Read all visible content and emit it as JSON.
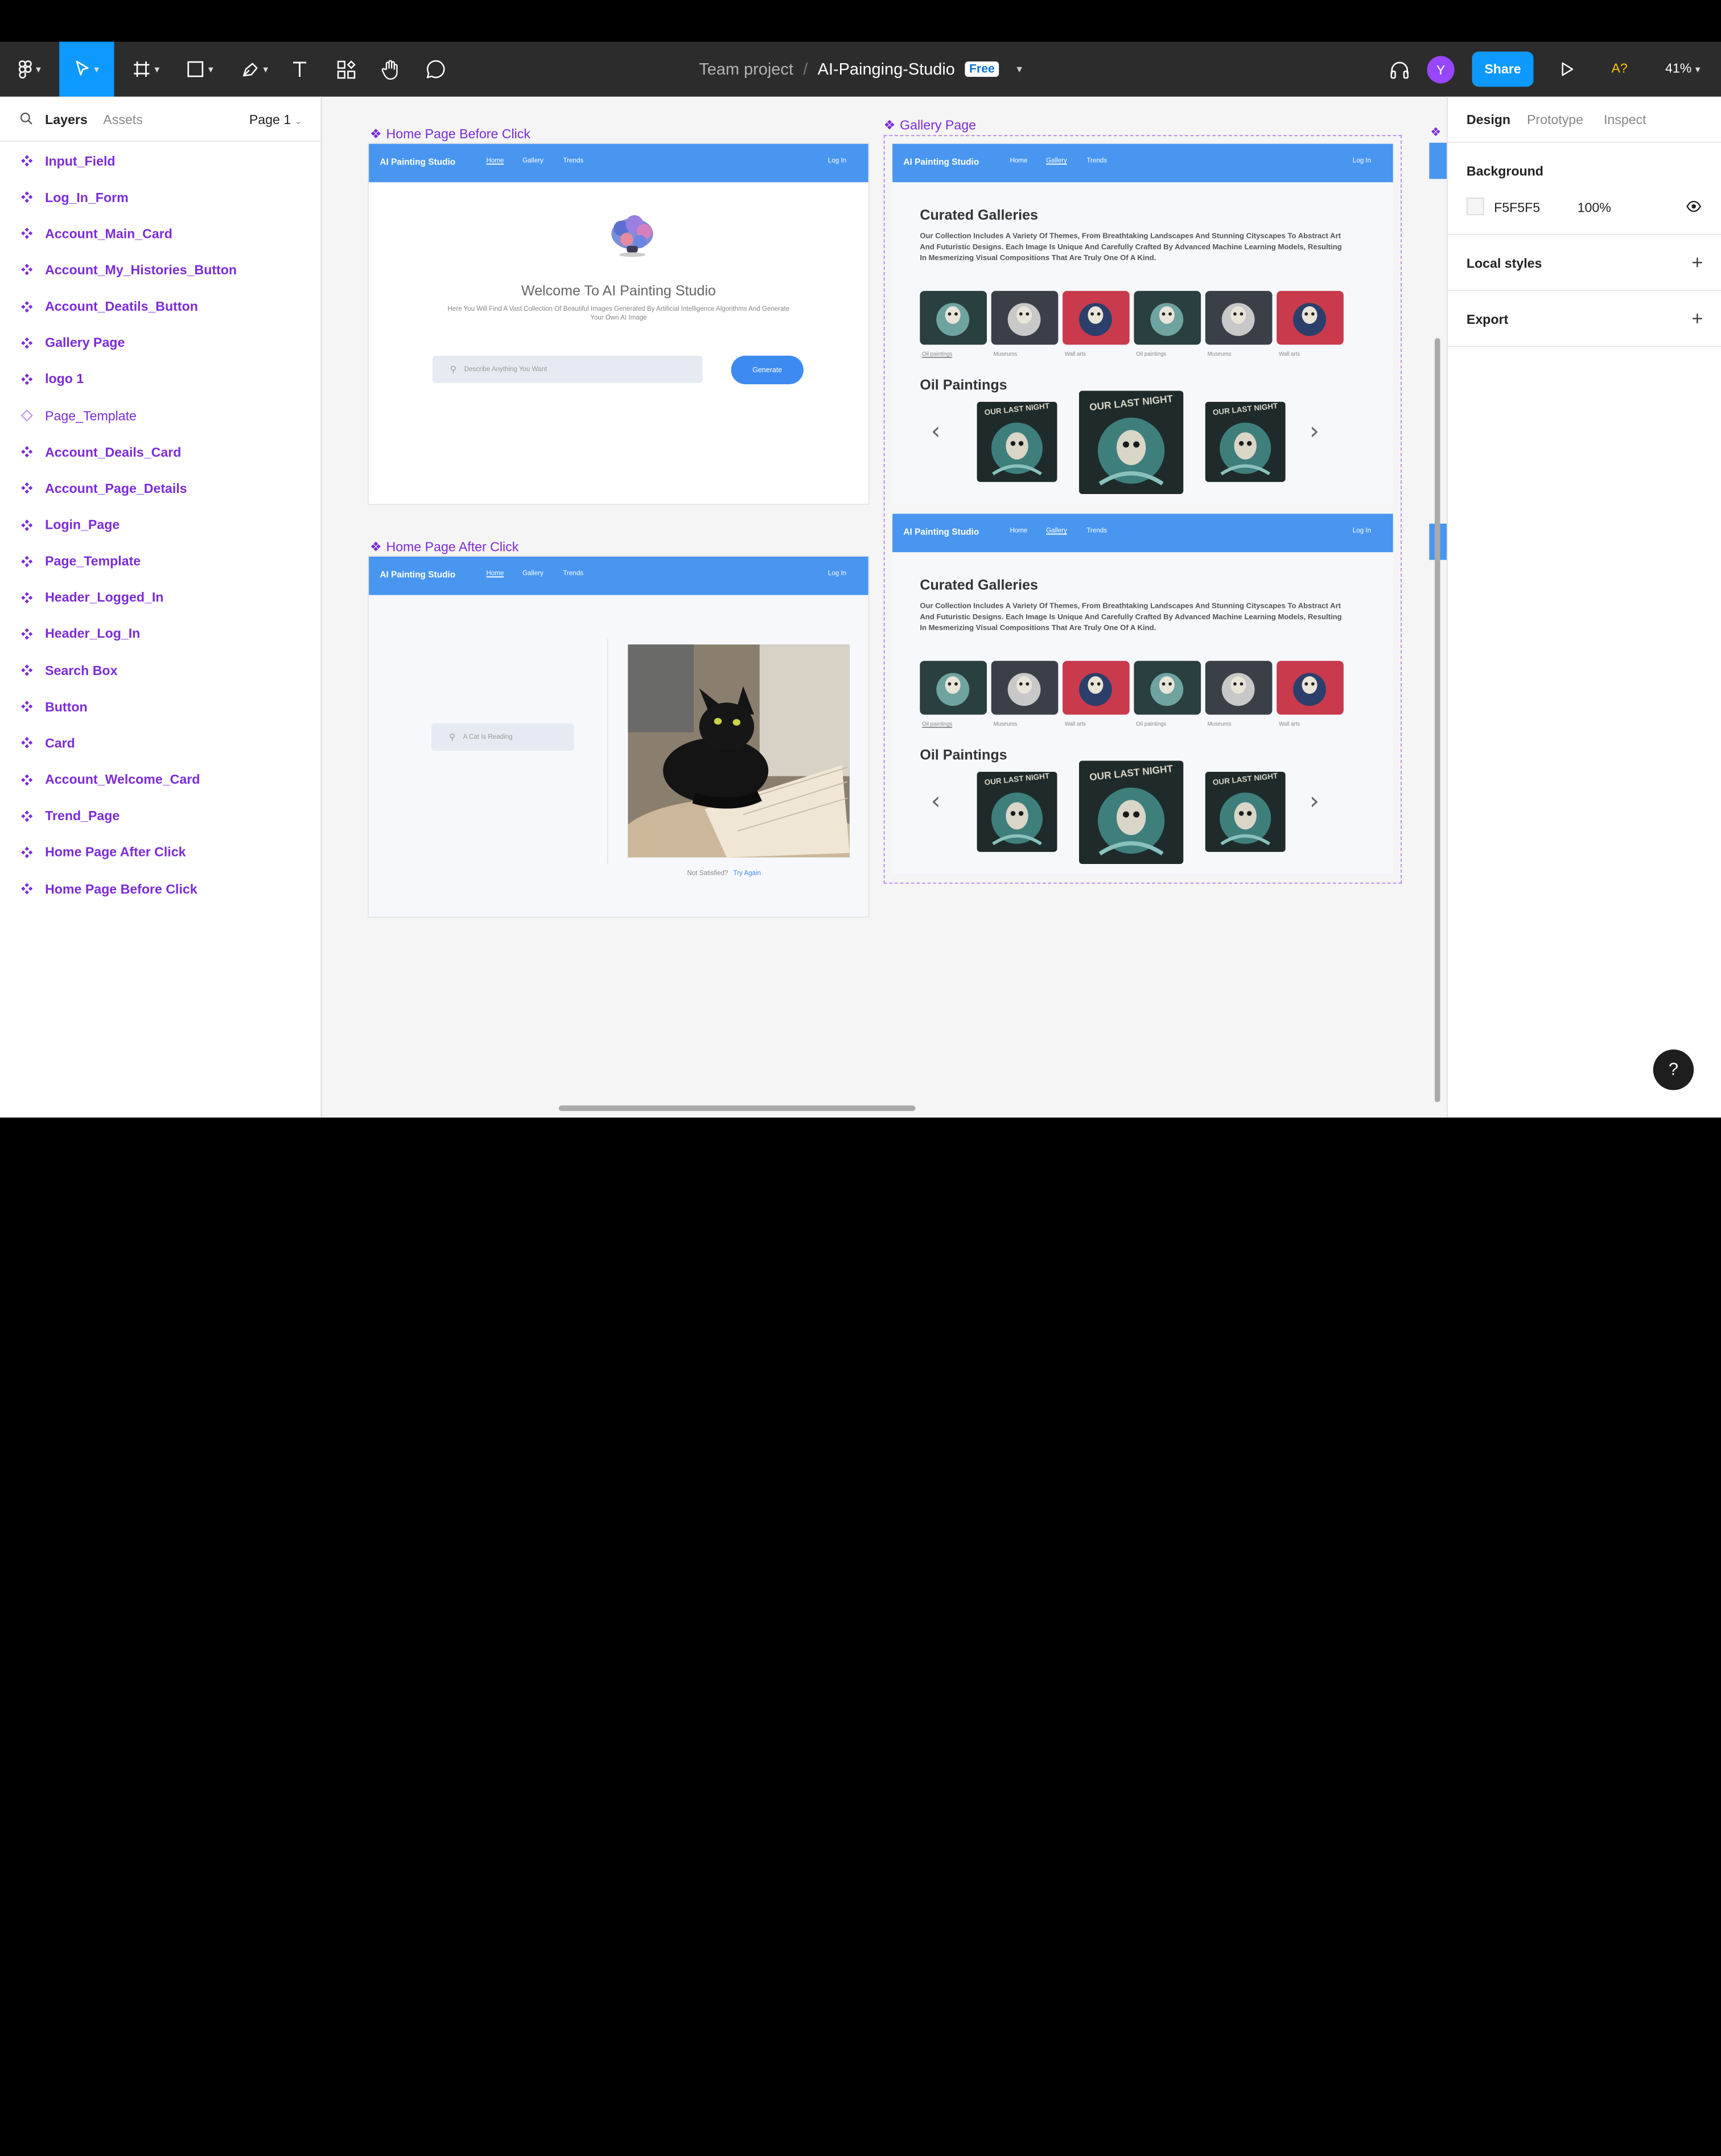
{
  "toolbar": {
    "breadcrumb_team": "Team project",
    "breadcrumb_sep": "/",
    "file_name": "AI-Painging-Studio",
    "plan_badge": "Free",
    "avatar_initial": "Y",
    "share_label": "Share",
    "a11y_label": "A?",
    "zoom_label": "41%",
    "accent": "#0d99ff"
  },
  "left_panel": {
    "tab_layers": "Layers",
    "tab_assets": "Assets",
    "page_selector": "Page 1",
    "layers": [
      {
        "label": "Input_Field",
        "icon": "component-icon"
      },
      {
        "label": "Log_In_Form",
        "icon": "component-icon"
      },
      {
        "label": "Account_Main_Card",
        "icon": "component-icon"
      },
      {
        "label": "Account_My_Histories_Button",
        "icon": "component-icon"
      },
      {
        "label": "Account_Deatils_Button",
        "icon": "component-icon"
      },
      {
        "label": "Gallery Page",
        "icon": "component-icon"
      },
      {
        "label": "logo 1",
        "icon": "component-icon"
      },
      {
        "label": "Page_Template",
        "icon": "instance-icon"
      },
      {
        "label": "Account_Deails_Card",
        "icon": "component-icon"
      },
      {
        "label": "Account_Page_Details",
        "icon": "component-icon"
      },
      {
        "label": "Login_Page",
        "icon": "component-icon"
      },
      {
        "label": "Page_Template",
        "icon": "component-icon"
      },
      {
        "label": "Header_Logged_In",
        "icon": "component-icon"
      },
      {
        "label": "Header_Log_In",
        "icon": "component-icon"
      },
      {
        "label": "Search Box",
        "icon": "component-icon"
      },
      {
        "label": "Button",
        "icon": "component-icon"
      },
      {
        "label": "Card",
        "icon": "component-icon"
      },
      {
        "label": "Account_Welcome_Card",
        "icon": "component-icon"
      },
      {
        "label": "Trend_Page",
        "icon": "component-icon"
      },
      {
        "label": "Home Page After Click",
        "icon": "component-icon"
      },
      {
        "label": "Home Page Before Click",
        "icon": "component-icon"
      }
    ]
  },
  "canvas": {
    "frame_home_before": "Home Page Before Click",
    "frame_home_after": "Home Page After Click",
    "frame_gallery": "Gallery Page",
    "site": {
      "logo": "AI Painting Studio",
      "nav_home": "Home",
      "nav_gallery": "Gallery",
      "nav_trends": "Trends",
      "login": "Log In"
    },
    "home_before": {
      "welcome": "Welcome To AI Painting Studio",
      "subtitle": "Here You Will Find A Vast Collection Of Beautiful Images Generated By Artificial Intelligence Algorithms And Generate Your Own AI Image",
      "search_placeholder": "Describe Anything You Want",
      "generate": "Generate"
    },
    "home_after": {
      "search_value": "A Cat Is Reading",
      "not_satisfied": "Not Satisfied?",
      "try_again": "Try Again"
    },
    "gallery": {
      "curated_title": "Curated Galleries",
      "curated_desc": "Our Collection Includes A Variety Of Themes, From Breathtaking Landscapes And Stunning Cityscapes To Abstract Art And Futuristic Designs. Each Image Is Unique And Carefully Crafted By Advanced Machine Learning Models, Resulting In Mesmerizing Visual Compositions That Are Truly One Of A Kind.",
      "thumb_captions": [
        "Oil paintings",
        "Museums",
        "Wall arts",
        "Oil paintings",
        "Museums",
        "Wall arts"
      ],
      "oil_title": "Oil Paintings",
      "poster_text": "OUR LAST NIGHT"
    }
  },
  "right_panel": {
    "tab_design": "Design",
    "tab_prototype": "Prototype",
    "tab_inspect": "Inspect",
    "background_label": "Background",
    "bg_hex": "F5F5F5",
    "bg_opacity": "100%",
    "local_styles": "Local styles",
    "export": "Export"
  },
  "help_label": "?"
}
